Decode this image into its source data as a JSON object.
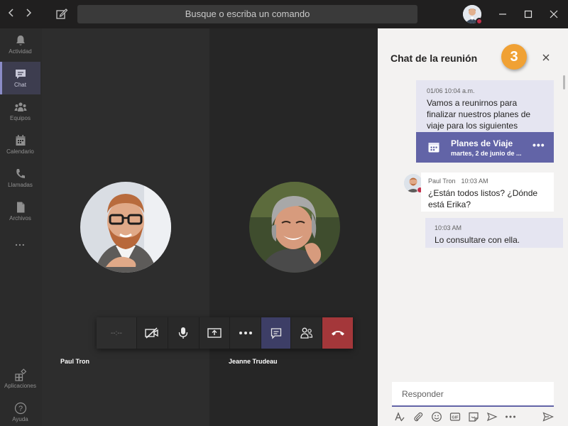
{
  "titlebar": {
    "search_placeholder": "Busque o escriba un comando",
    "back_icon": "chevron-left-icon",
    "forward_icon": "chevron-right-icon"
  },
  "rail": {
    "items": [
      {
        "label": "Actividad",
        "icon": "bell-icon"
      },
      {
        "label": "Chat",
        "icon": "chat-icon",
        "active": true
      },
      {
        "label": "Equipos",
        "icon": "teams-icon"
      },
      {
        "label": "Calendario",
        "icon": "calendar-icon"
      },
      {
        "label": "Llamadas",
        "icon": "phone-icon"
      },
      {
        "label": "Archivos",
        "icon": "file-icon"
      }
    ],
    "more": "...",
    "apps_label": "Aplicaciones",
    "help_label": "Ayuda"
  },
  "stage": {
    "participants": [
      {
        "name": "Paul Tron"
      },
      {
        "name": "Jeanne Trudeau"
      }
    ]
  },
  "callbar": {
    "timer": "--:--",
    "buttons": [
      "camera-off-icon",
      "microphone-icon",
      "share-screen-icon",
      "more-options-icon",
      "chat-icon",
      "participants-icon",
      "hang-up-icon"
    ]
  },
  "chat": {
    "title": "Chat de la reunión",
    "step_badge": "3",
    "messages": [
      {
        "meta": "01/06 10:04 a.m.",
        "text": "Vamos a reunirnos para finalizar nuestros planes de viaje para los siguientes congresos."
      },
      {
        "author": "Paul Tron",
        "time": "10:03 AM",
        "text": "¿Están todos listos? ¿Dónde está Erika?"
      },
      {
        "meta": "10:03 AM",
        "text": "Lo consultare con ella."
      }
    ],
    "card": {
      "title": "Planes de Viaje",
      "subtitle": "martes, 2 de junio de ...",
      "more": "•••"
    },
    "reply_placeholder": "Responder"
  },
  "colors": {
    "accent": "#6264a7",
    "hangup": "#a4373a",
    "badge": "#f0a134",
    "presence_busy": "#c4314b"
  }
}
